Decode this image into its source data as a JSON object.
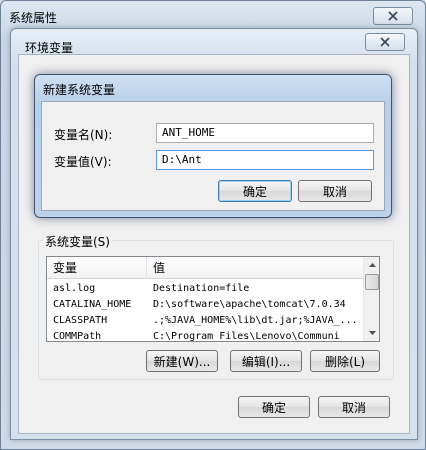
{
  "outer_window": {
    "title": "系统属性"
  },
  "env_window": {
    "title": "环境变量"
  },
  "new_var_dialog": {
    "title": "新建系统变量",
    "name_label": "变量名(N):",
    "name_value": "ANT_HOME",
    "value_label": "变量值(V):",
    "value_value": "D:\\Ant",
    "ok_label": "确定",
    "cancel_label": "取消"
  },
  "system_vars": {
    "group_title": "系统变量(S)",
    "columns": [
      "变量",
      "值"
    ],
    "rows": [
      {
        "name": "asl.log",
        "value": "Destination=file"
      },
      {
        "name": "CATALINA_HOME",
        "value": "D:\\software\\apache\\tomcat\\7.0.34"
      },
      {
        "name": "CLASSPATH",
        "value": ".;%JAVA_HOME%\\lib\\dt.jar;%JAVA_..."
      },
      {
        "name": "COMMPath",
        "value": "C:\\Program Files\\Lenovo\\Communi"
      }
    ],
    "new_label": "新建(W)...",
    "edit_label": "编辑(I)...",
    "delete_label": "删除(L)"
  },
  "env_buttons": {
    "ok_label": "确定",
    "cancel_label": "取消"
  },
  "icons": {
    "close": "close-icon",
    "scroll_up": "scroll-up-arrow-icon",
    "scroll_down": "scroll-down-arrow-icon"
  }
}
